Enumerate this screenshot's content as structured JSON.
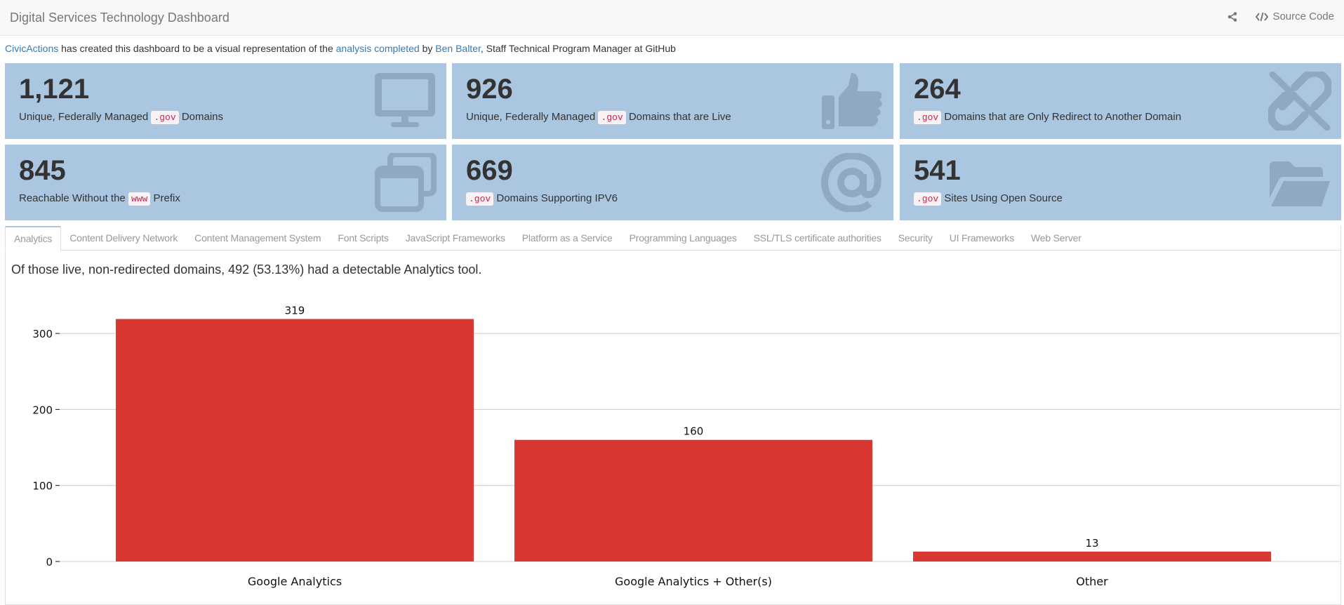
{
  "navbar": {
    "title": "Digital Services Technology Dashboard",
    "share_icon": "share-icon",
    "source_icon": "code-icon",
    "source_label": "Source Code"
  },
  "intro": {
    "org": "CivicActions",
    "text1": " has created this dashboard to be a visual representation of the ",
    "analysis": "analysis completed",
    "text2": " by ",
    "person": "Ben Balter",
    "text3": ", Staff Technical Program Manager at GitHub"
  },
  "stats": [
    {
      "value": "1,121",
      "pre": "Unique, Federally Managed ",
      "code": ".gov",
      "post": " Domains",
      "icon": "monitor-icon"
    },
    {
      "value": "926",
      "pre": "Unique, Federally Managed ",
      "code": ".gov",
      "post": " Domains that are Live",
      "icon": "thumbs-up-icon"
    },
    {
      "value": "264",
      "pre": "",
      "code": ".gov",
      "post": " Domains that are Only Redirect to Another Domain",
      "icon": "unlink-icon"
    },
    {
      "value": "845",
      "pre": "Reachable Without the ",
      "code": "www",
      "post": " Prefix",
      "icon": "windows-icon"
    },
    {
      "value": "669",
      "pre": "",
      "code": ".gov",
      "post": " Domains Supporting IPV6",
      "icon": "at-icon"
    },
    {
      "value": "541",
      "pre": "",
      "code": ".gov",
      "post": " Sites Using Open Source",
      "icon": "folder-open-icon"
    }
  ],
  "tabs": [
    "Analytics",
    "Content Delivery Network",
    "Content Management System",
    "Font Scripts",
    "JavaScript Frameworks",
    "Platform as a Service",
    "Programming Languages",
    "SSL/TLS certificate authorities",
    "Security",
    "UI Frameworks",
    "Web Server"
  ],
  "active_tab": "Analytics",
  "summary": "Of those live, non-redirected domains, 492 (53.13%) had a detectable Analytics tool.",
  "colors": {
    "bar": "#d93732",
    "stat_bg": "#abc6e0",
    "icon": "#8fa9c3",
    "link": "#337ab7"
  },
  "chart_data": {
    "type": "bar",
    "categories": [
      "Google Analytics",
      "Google Analytics + Other(s)",
      "Other"
    ],
    "values": [
      319,
      160,
      13
    ],
    "title": "",
    "xlabel": "",
    "ylabel": "",
    "ylim": [
      0,
      350
    ],
    "yticks": [
      0,
      100,
      200,
      300
    ],
    "grid": true,
    "data_labels": true
  }
}
